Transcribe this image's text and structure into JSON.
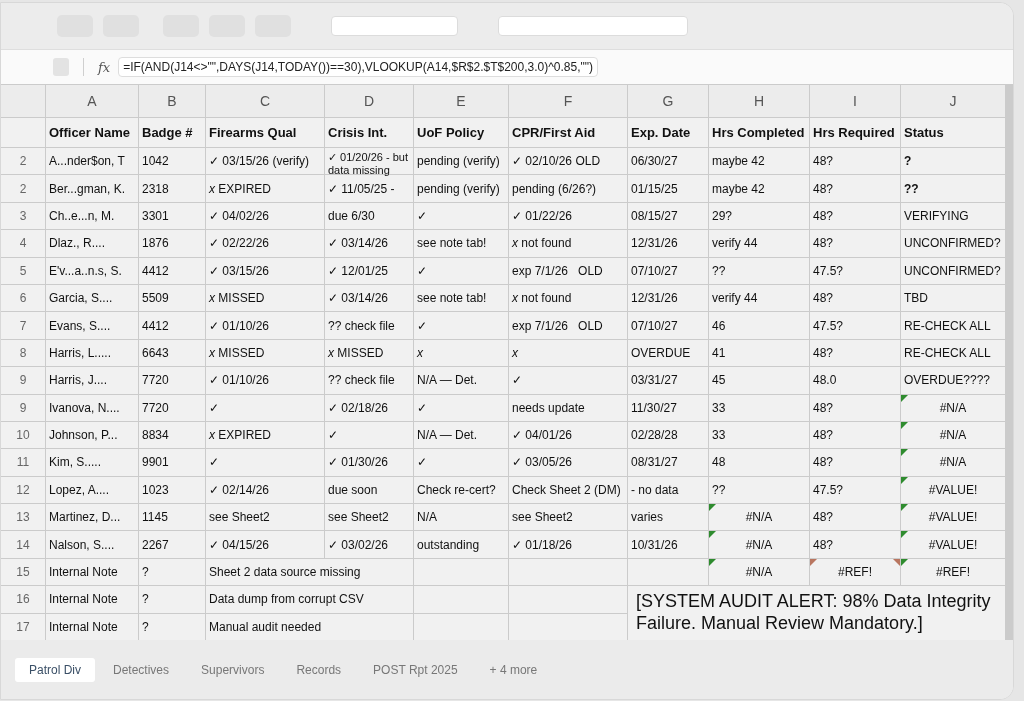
{
  "formula_bar": {
    "label": "fx",
    "formula": "=IF(AND(J14<>\"\",DAYS(J14,TODAY())==30),VLOOKUP(A14,$R$2.$T$200,3.0)^0.85,\"\")"
  },
  "columns": [
    "A",
    "B",
    "C",
    "D",
    "E",
    "F",
    "G",
    "H",
    "I",
    "J"
  ],
  "header": [
    "Officer Name",
    "Badge #",
    "Firearms Qual",
    "Crisis Int.",
    "UoF Policy",
    "CPR/First Aid",
    "Exp. Date",
    "Hrs Completed",
    "Hrs Required",
    "Status"
  ],
  "rows": [
    {
      "number": "2",
      "cells": [
        "A...nder$on, T",
        "1042",
        "✓ 03/15/26 (verify)",
        {
          "text": "✓ 01/20/26 - but data missing",
          "kind": "wrap"
        },
        "pending (verify)",
        "✓ 02/10/26 OLD",
        "06/30/27",
        "maybe 42",
        "48?",
        {
          "text": "?",
          "bold": true
        }
      ]
    },
    {
      "number": "2",
      "cells": [
        "Ber...gman, K.",
        "2318",
        "*x* EXPIRED",
        "✓ 11/05/25 -",
        "pending (verify)",
        "pending (6/26?)",
        "01/15/25",
        "maybe 42",
        "48?",
        {
          "text": "??",
          "bold": true
        }
      ]
    },
    {
      "number": "3",
      "cells": [
        "Ch..e...n, M.",
        "3301",
        "✓ 04/02/26",
        "due 6/30",
        "✓",
        "✓ 01/22/26",
        "08/15/27",
        "29?",
        "48?",
        "VERIFYING"
      ]
    },
    {
      "number": "4",
      "cells": [
        "Dlaz., R....",
        "1876",
        "✓ 02/22/26",
        "✓ 03/14/26",
        "see note tab!",
        "*x* not found",
        "12/31/26",
        "verify 44",
        "48?",
        "UNCONFIRMED?"
      ]
    },
    {
      "number": "5",
      "cells": [
        "E'v...a..n.s, S.",
        "4412",
        "✓ 03/15/26",
        "✓ 12/01/25",
        "✓",
        "exp 7/1/26   OLD",
        "07/10/27",
        "??",
        "47.5?",
        "UNCONFIRMED?"
      ]
    },
    {
      "number": "6",
      "cells": [
        "Garcia, S....",
        "5509",
        "*x* MISSED",
        "✓ 03/14/26",
        "see note tab!",
        "*x* not found",
        "12/31/26",
        "verify 44",
        "48?",
        "TBD"
      ]
    },
    {
      "number": "7",
      "cells": [
        "Evans, S....",
        "4412",
        "✓ 01/10/26",
        "?? check file",
        "✓",
        "exp 7/1/26   OLD",
        "07/10/27",
        "46",
        "47.5?",
        "RE-CHECK ALL"
      ]
    },
    {
      "number": "8",
      "cells": [
        "Harris, L.....",
        "6643",
        "*x* MISSED",
        "*x* MISSED",
        "*x*",
        "*x*",
        "OVERDUE",
        "41",
        "48?",
        "RE-CHECK ALL"
      ]
    },
    {
      "number": "9",
      "cells": [
        "Harris, J....",
        "7720",
        "✓ 01/10/26",
        "?? check file",
        "N/A — Det.",
        "✓",
        "03/31/27",
        "45",
        "48.0",
        "OVERDUE????"
      ]
    },
    {
      "number": "9",
      "cells": [
        "Ivanova, N....",
        "7720",
        "✓",
        "✓ 02/18/26",
        "✓",
        "needs update",
        "11/30/27",
        "33",
        "48?",
        {
          "text": "#N/A",
          "flag": true,
          "color": "#2e8b2e"
        }
      ]
    },
    {
      "number": "10",
      "cells": [
        "Johnson, P...",
        "8834",
        "*x* EXPIRED",
        "✓",
        "N/A — Det.",
        "✓ 04/01/26",
        "02/28/28",
        "33",
        "48?",
        {
          "text": "#N/A",
          "flag": true,
          "color": "#2e8b2e"
        }
      ]
    },
    {
      "number": "11",
      "cells": [
        "Kim, S.....",
        "9901",
        "✓",
        "✓ 01/30/26",
        "✓",
        "✓ 03/05/26",
        "08/31/27",
        "48",
        "48?",
        {
          "text": "#N/A",
          "flag": true,
          "color": "#2e8b2e"
        }
      ]
    },
    {
      "number": "12",
      "cells": [
        "Lopez, A....",
        "1023",
        "✓ 02/14/26",
        "due soon",
        "Check re-cert?",
        "Check Sheet 2 (DM)",
        "- no data",
        "??",
        "47.5?",
        {
          "text": "#VALUE!",
          "flag": true,
          "color": "#2e8b2e"
        }
      ]
    },
    {
      "number": "13",
      "cells": [
        "Martinez, D...",
        "1145",
        "see Sheet2",
        "see Sheet2",
        "N/A",
        "see Sheet2",
        "varies",
        {
          "text": "#N/A",
          "flag": true,
          "color": "#2e8b2e"
        },
        "48?",
        {
          "text": "#VALUE!",
          "flag": true,
          "color": "#2e8b2e"
        }
      ]
    },
    {
      "number": "14",
      "cells": [
        "Nalson, S....",
        "2267",
        "✓ 04/15/26",
        "✓ 03/02/26",
        "outstanding",
        "✓ 01/18/26",
        "10/31/26",
        {
          "text": "#N/A",
          "flag": true,
          "color": "#2e8b2e"
        },
        "48?",
        {
          "text": "#VALUE!",
          "flag": true,
          "color": "#2e8b2e"
        }
      ]
    },
    {
      "number": "15",
      "cells": [
        "Internal Note",
        "?",
        {
          "text": "Sheet 2 data source missing",
          "kind": "merged"
        },
        null,
        null,
        null,
        {
          "text": "#N/A",
          "flag": true,
          "color": "#2e8b2e"
        },
        {
          "text": "#REF!",
          "flag": true,
          "flag_right": true,
          "color": "#b97660"
        },
        {
          "text": "#REF!",
          "flag": true,
          "color": "#2e8b2e"
        }
      ]
    },
    {
      "number": "16",
      "cells": [
        "Internal Note",
        "?",
        {
          "text": "Data dump from corrupt CSV",
          "kind": "merged"
        },
        null,
        null,
        {
          "text": "[SYSTEM AUDIT ALERT: 98% Data Integrity Failure.  Manual Review Mandatory.]",
          "kind": "alert"
        }
      ]
    },
    {
      "number": "17",
      "cells": [
        "Internal Note",
        "?",
        {
          "text": "Manual audit needed",
          "kind": "merged"
        },
        null,
        null
      ]
    }
  ],
  "sheet_tabs": [
    {
      "label": "Patrol Div",
      "selected": true
    },
    {
      "label": "Detectives",
      "selected": false
    },
    {
      "label": "Supervivors",
      "selected": false
    },
    {
      "label": "Records",
      "selected": false
    },
    {
      "label": "POST Rpt 2025",
      "selected": false
    }
  ],
  "more_tabs": "+ 4 more"
}
